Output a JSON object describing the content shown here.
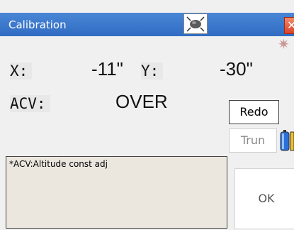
{
  "window": {
    "title": "Calibration",
    "close_label": "✕"
  },
  "readings": {
    "x_label": "X:",
    "x_value": "-11\"",
    "y_label": "Y:",
    "y_value": "-30\"",
    "acv_label": "ACV:",
    "acv_value": "OVER"
  },
  "buttons": {
    "redo": "Redo",
    "trun": "Trun",
    "ok": "OK"
  },
  "note": "*ACV:Altitude const adj"
}
